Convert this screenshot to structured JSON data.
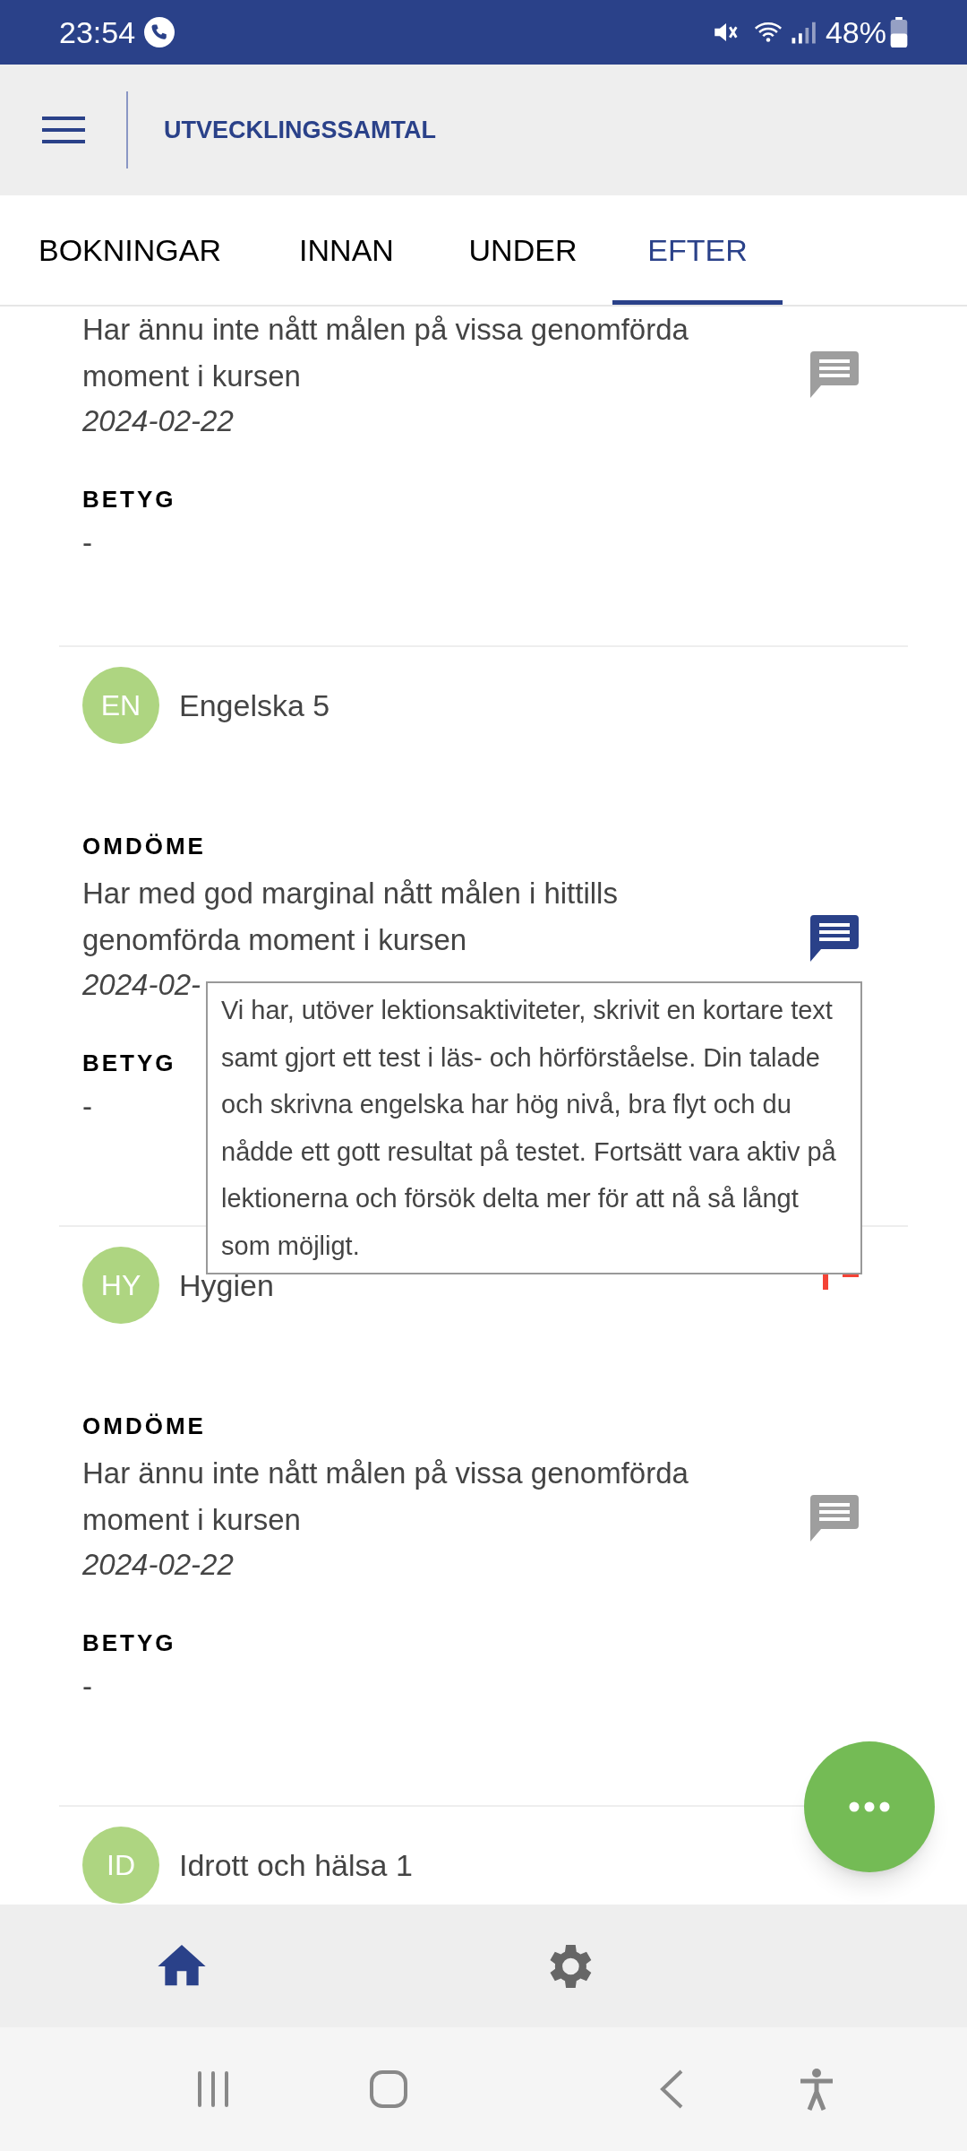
{
  "status_bar": {
    "time": "23:54",
    "battery": "48%"
  },
  "app_bar": {
    "title": "UTVECKLINGSSAMTAL"
  },
  "tabs": [
    {
      "label": "BOKNINGAR",
      "selected": false
    },
    {
      "label": "INNAN",
      "selected": false
    },
    {
      "label": "UNDER",
      "selected": false
    },
    {
      "label": "EFTER",
      "selected": true
    }
  ],
  "courses": [
    {
      "omdome": {
        "text": "Har ännu inte nått målen på vissa genomförda moment i kursen",
        "date": "2024-02-22",
        "comment_active": false
      },
      "betyg": {
        "label": "BETYG",
        "value": "-"
      }
    },
    {
      "initials": "EN",
      "name": "Engelska 5",
      "flagged": false,
      "omdome": {
        "label": "OMDÖME",
        "text": "Har med god marginal nått målen i hittills genomförda moment i kursen",
        "date": "2024-02-",
        "comment_active": true
      },
      "betyg": {
        "label": "BETYG",
        "value": "-"
      }
    },
    {
      "initials": "HY",
      "name": "Hygien",
      "flagged": true,
      "omdome": {
        "label": "OMDÖME",
        "text": "Har ännu inte nått målen på vissa genomförda moment i kursen",
        "date": "2024-02-22",
        "comment_active": false
      },
      "betyg": {
        "label": "BETYG",
        "value": "-"
      }
    },
    {
      "initials": "ID",
      "name": "Idrott och hälsa 1",
      "flagged": false
    }
  ],
  "tooltip": {
    "text": "Vi har, utöver lektionsaktiviteter, skrivit en kortare text samt gjort ett test i läs- och hörförståelse. Din talade och skrivna engelska har hög nivå, bra flyt och du nådde ett gott resultat på testet. Fortsätt vara aktiv på lektionerna och försök delta mer för att nå så långt som möjligt."
  },
  "bottom_nav": [
    {
      "kind": "home",
      "selected": true
    },
    {
      "kind": "settings",
      "selected": false
    }
  ]
}
